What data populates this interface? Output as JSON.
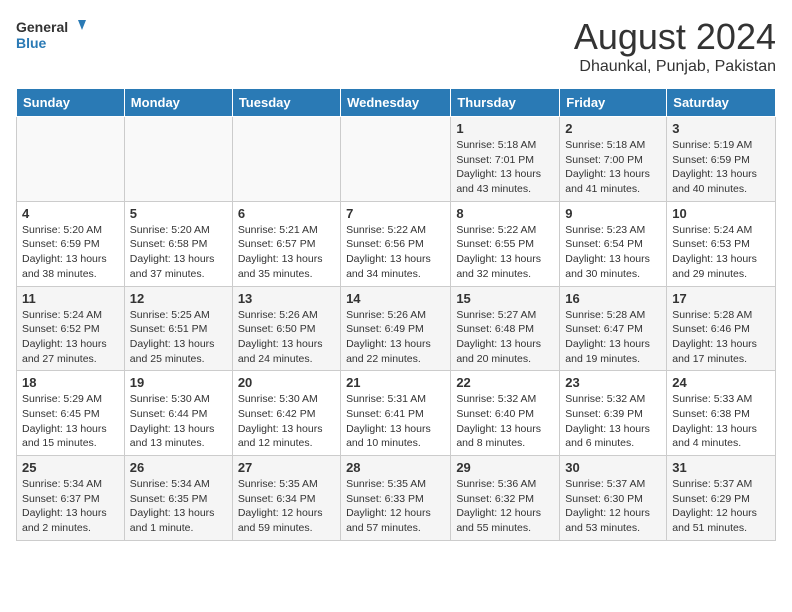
{
  "header": {
    "logo_line1": "General",
    "logo_line2": "Blue",
    "title": "August 2024",
    "subtitle": "Dhaunkal, Punjab, Pakistan"
  },
  "weekdays": [
    "Sunday",
    "Monday",
    "Tuesday",
    "Wednesday",
    "Thursday",
    "Friday",
    "Saturday"
  ],
  "weeks": [
    [
      {
        "num": "",
        "detail": ""
      },
      {
        "num": "",
        "detail": ""
      },
      {
        "num": "",
        "detail": ""
      },
      {
        "num": "",
        "detail": ""
      },
      {
        "num": "1",
        "detail": "Sunrise: 5:18 AM\nSunset: 7:01 PM\nDaylight: 13 hours\nand 43 minutes."
      },
      {
        "num": "2",
        "detail": "Sunrise: 5:18 AM\nSunset: 7:00 PM\nDaylight: 13 hours\nand 41 minutes."
      },
      {
        "num": "3",
        "detail": "Sunrise: 5:19 AM\nSunset: 6:59 PM\nDaylight: 13 hours\nand 40 minutes."
      }
    ],
    [
      {
        "num": "4",
        "detail": "Sunrise: 5:20 AM\nSunset: 6:59 PM\nDaylight: 13 hours\nand 38 minutes."
      },
      {
        "num": "5",
        "detail": "Sunrise: 5:20 AM\nSunset: 6:58 PM\nDaylight: 13 hours\nand 37 minutes."
      },
      {
        "num": "6",
        "detail": "Sunrise: 5:21 AM\nSunset: 6:57 PM\nDaylight: 13 hours\nand 35 minutes."
      },
      {
        "num": "7",
        "detail": "Sunrise: 5:22 AM\nSunset: 6:56 PM\nDaylight: 13 hours\nand 34 minutes."
      },
      {
        "num": "8",
        "detail": "Sunrise: 5:22 AM\nSunset: 6:55 PM\nDaylight: 13 hours\nand 32 minutes."
      },
      {
        "num": "9",
        "detail": "Sunrise: 5:23 AM\nSunset: 6:54 PM\nDaylight: 13 hours\nand 30 minutes."
      },
      {
        "num": "10",
        "detail": "Sunrise: 5:24 AM\nSunset: 6:53 PM\nDaylight: 13 hours\nand 29 minutes."
      }
    ],
    [
      {
        "num": "11",
        "detail": "Sunrise: 5:24 AM\nSunset: 6:52 PM\nDaylight: 13 hours\nand 27 minutes."
      },
      {
        "num": "12",
        "detail": "Sunrise: 5:25 AM\nSunset: 6:51 PM\nDaylight: 13 hours\nand 25 minutes."
      },
      {
        "num": "13",
        "detail": "Sunrise: 5:26 AM\nSunset: 6:50 PM\nDaylight: 13 hours\nand 24 minutes."
      },
      {
        "num": "14",
        "detail": "Sunrise: 5:26 AM\nSunset: 6:49 PM\nDaylight: 13 hours\nand 22 minutes."
      },
      {
        "num": "15",
        "detail": "Sunrise: 5:27 AM\nSunset: 6:48 PM\nDaylight: 13 hours\nand 20 minutes."
      },
      {
        "num": "16",
        "detail": "Sunrise: 5:28 AM\nSunset: 6:47 PM\nDaylight: 13 hours\nand 19 minutes."
      },
      {
        "num": "17",
        "detail": "Sunrise: 5:28 AM\nSunset: 6:46 PM\nDaylight: 13 hours\nand 17 minutes."
      }
    ],
    [
      {
        "num": "18",
        "detail": "Sunrise: 5:29 AM\nSunset: 6:45 PM\nDaylight: 13 hours\nand 15 minutes."
      },
      {
        "num": "19",
        "detail": "Sunrise: 5:30 AM\nSunset: 6:44 PM\nDaylight: 13 hours\nand 13 minutes."
      },
      {
        "num": "20",
        "detail": "Sunrise: 5:30 AM\nSunset: 6:42 PM\nDaylight: 13 hours\nand 12 minutes."
      },
      {
        "num": "21",
        "detail": "Sunrise: 5:31 AM\nSunset: 6:41 PM\nDaylight: 13 hours\nand 10 minutes."
      },
      {
        "num": "22",
        "detail": "Sunrise: 5:32 AM\nSunset: 6:40 PM\nDaylight: 13 hours\nand 8 minutes."
      },
      {
        "num": "23",
        "detail": "Sunrise: 5:32 AM\nSunset: 6:39 PM\nDaylight: 13 hours\nand 6 minutes."
      },
      {
        "num": "24",
        "detail": "Sunrise: 5:33 AM\nSunset: 6:38 PM\nDaylight: 13 hours\nand 4 minutes."
      }
    ],
    [
      {
        "num": "25",
        "detail": "Sunrise: 5:34 AM\nSunset: 6:37 PM\nDaylight: 13 hours\nand 2 minutes."
      },
      {
        "num": "26",
        "detail": "Sunrise: 5:34 AM\nSunset: 6:35 PM\nDaylight: 13 hours\nand 1 minute."
      },
      {
        "num": "27",
        "detail": "Sunrise: 5:35 AM\nSunset: 6:34 PM\nDaylight: 12 hours\nand 59 minutes."
      },
      {
        "num": "28",
        "detail": "Sunrise: 5:35 AM\nSunset: 6:33 PM\nDaylight: 12 hours\nand 57 minutes."
      },
      {
        "num": "29",
        "detail": "Sunrise: 5:36 AM\nSunset: 6:32 PM\nDaylight: 12 hours\nand 55 minutes."
      },
      {
        "num": "30",
        "detail": "Sunrise: 5:37 AM\nSunset: 6:30 PM\nDaylight: 12 hours\nand 53 minutes."
      },
      {
        "num": "31",
        "detail": "Sunrise: 5:37 AM\nSunset: 6:29 PM\nDaylight: 12 hours\nand 51 minutes."
      }
    ]
  ]
}
